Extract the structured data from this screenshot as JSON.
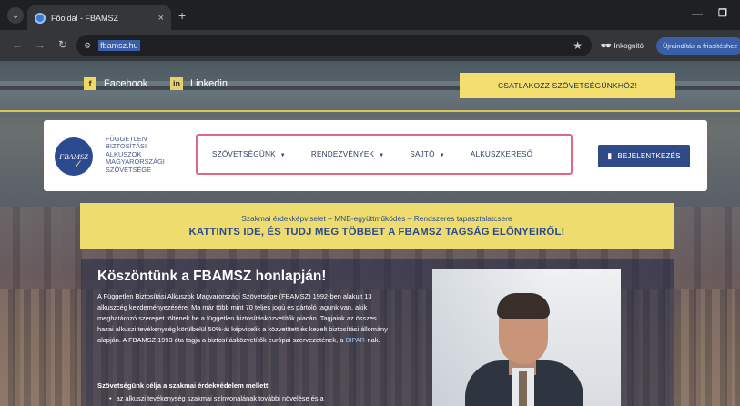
{
  "browser": {
    "tab_title": "Főoldal - FBAMSZ",
    "tab_close": "×",
    "new_tab": "+",
    "url": "fbamsz.hu",
    "incognito_label": "Inkognitó",
    "relaunch_label": "Újraindítás a frissítéshez",
    "icons": [
      "tab-list-icon",
      "favicon",
      "close-icon",
      "plus-icon",
      "back-icon",
      "forward-icon",
      "reload-icon",
      "site-info-icon",
      "star-icon",
      "incognito-icon",
      "minimize-icon",
      "maximize-icon"
    ]
  },
  "topbar": {
    "facebook_label": "Facebook",
    "facebook_icon": "f",
    "linkedin_label": "Linkedin",
    "linkedin_icon": "in",
    "join_label": "CSATLAKOZZ SZÖVETSÉGÜNKHÖZ!"
  },
  "header": {
    "logo_mark": "FBAMSZ",
    "logo_lines": [
      "FÜGGETLEN",
      "BIZTOSÍTÁSI",
      "ALKUSZOK",
      "MAGYARORSZÁGI",
      "SZÖVETSÉGE"
    ],
    "menu": [
      {
        "label": "SZÖVETSÉGÜNK",
        "caret": "▼"
      },
      {
        "label": "RENDEZVÉNYEK",
        "caret": "▼"
      },
      {
        "label": "SAJTÓ",
        "caret": "▼"
      },
      {
        "label": "ALKUSZKERESŐ"
      }
    ],
    "login_label": "BEJELENTKEZÉS"
  },
  "banner": {
    "subtitle": "Szakmai érdekképviselet – MNB-együttműködés – Rendszeres tapasztalatcsere",
    "title": "KATTINTS IDE, ÉS TUDJ MEG TÖBBET A FBAMSZ TAGSÁG ELŐNYEIRŐL!"
  },
  "main": {
    "heading": "Köszöntünk a FBAMSZ honlapján!",
    "intro_text": "A Független Biztosítási Alkuszok Magyarországi Szövetsége (FBAMSZ) 1992-ben alakult 13 alkuszcég kezdeményezésére. Ma már több mint 70 teljes jogú és pártoló tagunk van, akik meghatározó szerepet töltenek be a független biztosításközvetítők piacán. Tagjaink az összes hazai alkuszi tevékenység körülbelül 50%-át képviselik a közvetített és kezelt biztosítási állomány alapján. A FBAMSZ 1993 óta tagja a biztosításközvetítők európai szervezetének, a ",
    "bipar_link": "BIPAR",
    "intro_suffix": "-nak.",
    "goal_title": "Szövetségünk célja a szakmai érdekvédelem mellett",
    "goal_bullet": "az alkuszi tevékenység szakmai színvonalának további növelése és a",
    "bullet_glyph": "•"
  }
}
